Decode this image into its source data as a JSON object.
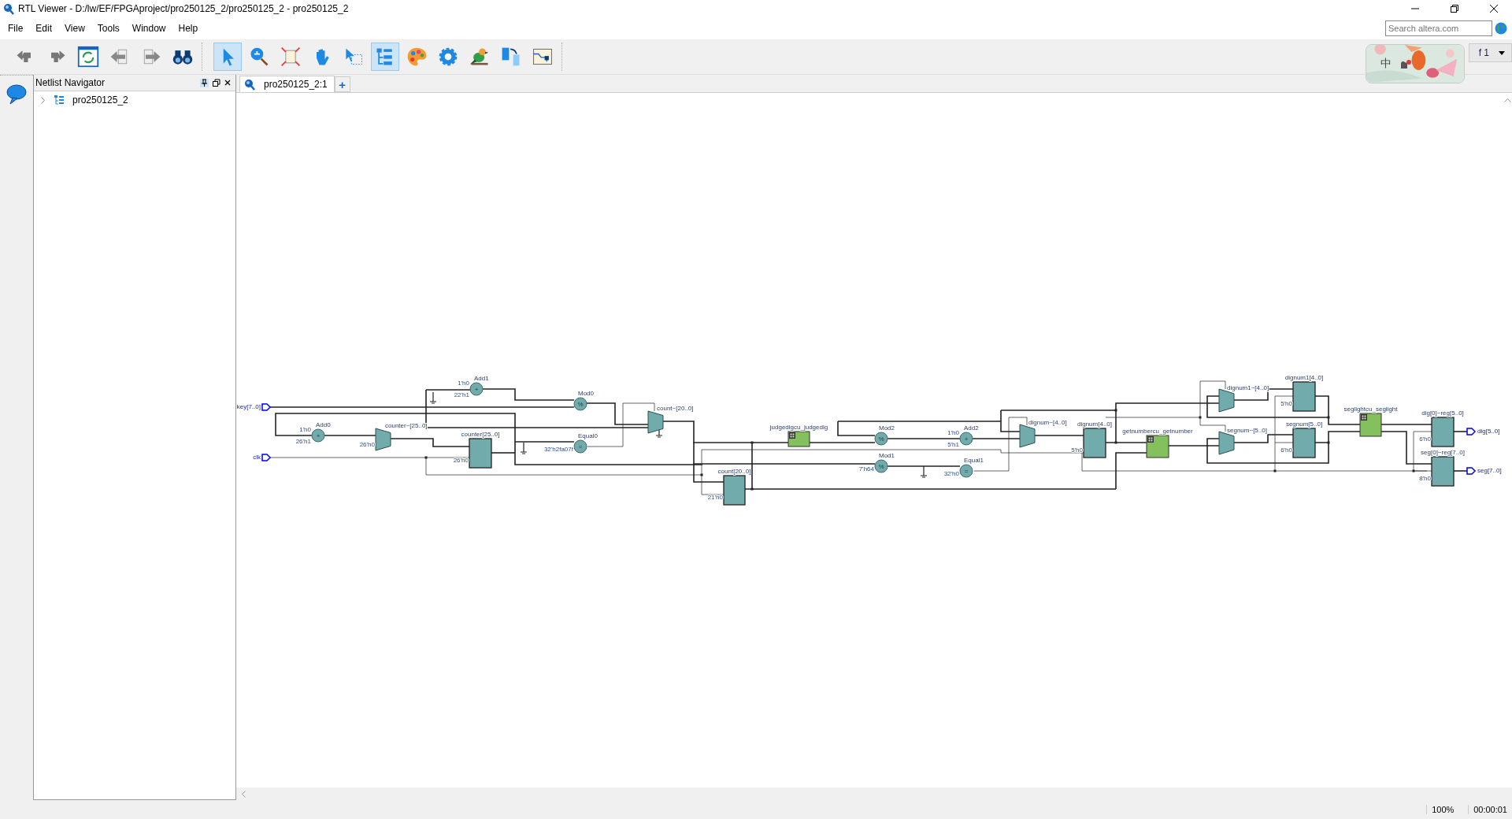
{
  "window": {
    "title": "RTL Viewer - D:/lw/EF/FPGAproject/pro250125_2/pro250125_2 - pro250125_2"
  },
  "menu": [
    "File",
    "Edit",
    "View",
    "Tools",
    "Window",
    "Help"
  ],
  "search": {
    "placeholder": "Search altera.com"
  },
  "toolbar": {
    "groups": [
      [
        {
          "selected": false
        },
        {
          "selected": false
        },
        {
          "selected": false
        },
        {
          "selected": false
        },
        {
          "selected": false
        },
        {
          "selected": false
        }
      ],
      [
        {
          "selected": true
        },
        {
          "selected": false
        },
        {
          "selected": false
        },
        {
          "selected": false
        },
        {
          "selected": false
        },
        {
          "selected": true
        },
        {
          "selected": false
        },
        {
          "selected": false
        },
        {
          "selected": false
        },
        {
          "selected": false
        },
        {
          "selected": false
        }
      ]
    ]
  },
  "page_selector": {
    "value": "f 1"
  },
  "ime_bar": {
    "mode": "中"
  },
  "navigator": {
    "title": "Netlist Navigator",
    "tree": [
      {
        "label": "pro250125_2",
        "expanded": false
      }
    ]
  },
  "tabs": [
    {
      "label": "pro250125_2:1",
      "selected": true
    }
  ],
  "add_tab": "+",
  "schematic": {
    "nodes": [
      {
        "kind": "port_in",
        "label": "key[7..0]"
      },
      {
        "kind": "port_in",
        "label": "clk"
      },
      {
        "kind": "op",
        "label": "Add0",
        "symbol": "+",
        "constants": [
          "1'h0",
          "26'h1"
        ]
      },
      {
        "kind": "mux",
        "label": "counter~[25..0]",
        "constants": [
          "26'h0"
        ]
      },
      {
        "kind": "op",
        "label": "Add1",
        "symbol": "+",
        "constants": [
          "1'h0",
          "22'h1"
        ]
      },
      {
        "kind": "reg",
        "label": "counter[25..0]",
        "constants": [
          "26'h0"
        ]
      },
      {
        "kind": "op",
        "label": "Mod0",
        "symbol": "%"
      },
      {
        "kind": "op",
        "label": "Equal0",
        "symbol": "=",
        "constants": [
          "32'h2fa07f"
        ]
      },
      {
        "kind": "mux",
        "label": "count~[20..0]"
      },
      {
        "kind": "reg",
        "label": "count[20..0]",
        "constants": [
          "21'h0"
        ]
      },
      {
        "kind": "instance",
        "label": "judgedigcu_judgedig"
      },
      {
        "kind": "op",
        "label": "Mod2",
        "symbol": "%"
      },
      {
        "kind": "op",
        "label": "Mod1",
        "symbol": "%",
        "constants": [
          "7'h64"
        ]
      },
      {
        "kind": "op",
        "label": "Add2",
        "symbol": "+",
        "constants": [
          "1'h0",
          "5'h1"
        ]
      },
      {
        "kind": "op",
        "label": "Equal1",
        "symbol": "=",
        "constants": [
          "32'h0"
        ]
      },
      {
        "kind": "mux",
        "label": "dignum~[4..0]"
      },
      {
        "kind": "reg",
        "label": "dignum[4..0]",
        "constants": [
          "5'h0"
        ]
      },
      {
        "kind": "instance",
        "label": "getnumbercu_getnumber"
      },
      {
        "kind": "mux",
        "label": "dignum1~[4..0]"
      },
      {
        "kind": "mux",
        "label": "segnum~[5..0]"
      },
      {
        "kind": "reg",
        "label": "dignum1[4..0]",
        "constants": [
          "5'h0"
        ]
      },
      {
        "kind": "reg",
        "label": "segnum[5..0]",
        "constants": [
          "6'h0"
        ]
      },
      {
        "kind": "instance",
        "label": "seglightcu_seglight"
      },
      {
        "kind": "reg",
        "label": "dig[0]~reg[5..0]",
        "constants": [
          "6'h0"
        ]
      },
      {
        "kind": "reg",
        "label": "seg[0]~reg[7..0]",
        "constants": [
          "8'h0"
        ]
      },
      {
        "kind": "port_out",
        "label": "dig[5..0]"
      },
      {
        "kind": "port_out",
        "label": "seg[7..0]"
      }
    ]
  },
  "status_bar": {
    "zoom": "100%",
    "time": "00:00:01"
  }
}
